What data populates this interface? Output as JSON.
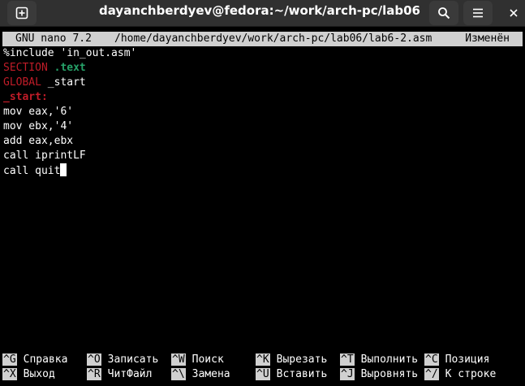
{
  "window": {
    "title": "dayanchberdyev@fedora:~/work/arch-pc/lab06",
    "icons": {
      "new_tab": "plus-square-icon",
      "search": "search-icon",
      "menu": "hamburger-menu-icon",
      "close": "close-icon"
    }
  },
  "nano": {
    "version": "GNU nano 7.2",
    "path": "/home/dayanchberdyev/work/arch-pc/lab06/lab6-2.asm",
    "status": "Изменён"
  },
  "editor": {
    "lines": [
      {
        "text": "%include 'in_out.asm'"
      },
      {
        "keyword": "SECTION",
        "arg": ".text"
      },
      {
        "keyword": "GLOBAL",
        "arg": " _start"
      },
      {
        "label": "_start:"
      },
      {
        "text": "mov eax,'6'"
      },
      {
        "text": "mov ebx,'4'"
      },
      {
        "text": "add eax,ebx"
      },
      {
        "text": "call iprintLF"
      },
      {
        "text": "call quit"
      }
    ]
  },
  "help": {
    "row1": [
      {
        "key": "^G",
        "label": "Справка"
      },
      {
        "key": "^O",
        "label": "Записать"
      },
      {
        "key": "^W",
        "label": "Поиск"
      },
      {
        "key": "^K",
        "label": "Вырезать"
      },
      {
        "key": "^T",
        "label": "Выполнить"
      },
      {
        "key": "^C",
        "label": "Позиция"
      }
    ],
    "row2": [
      {
        "key": "^X",
        "label": "Выход"
      },
      {
        "key": "^R",
        "label": "ЧитФайл"
      },
      {
        "key": "^\\",
        "label": "Замена"
      },
      {
        "key": "^U",
        "label": "Вставить"
      },
      {
        "key": "^J",
        "label": "Выровнять"
      },
      {
        "key": "^/",
        "label": "К строке"
      }
    ]
  }
}
